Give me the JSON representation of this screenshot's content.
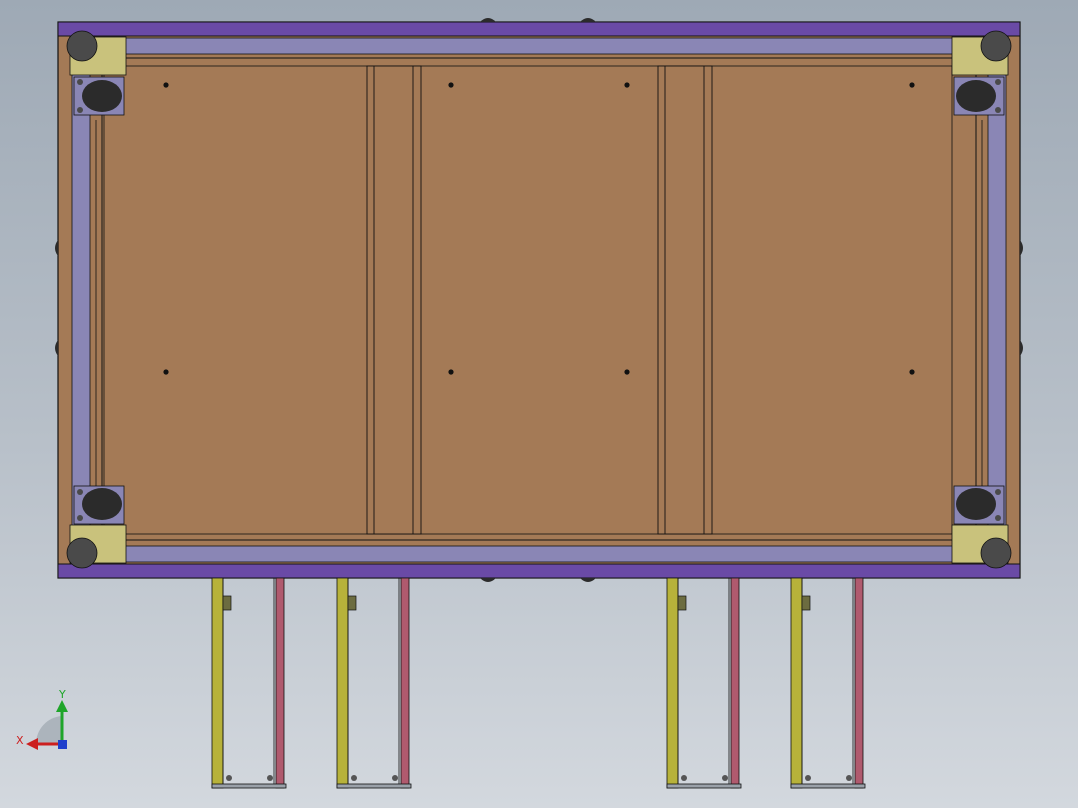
{
  "view": {
    "background_top": "#9ea9b5",
    "background_bottom": "#d3d8de"
  },
  "colors": {
    "frame_rail": "#6a4aa6",
    "frame_rail_dark": "#3d2a66",
    "inner_rail": "#8a86b5",
    "inner_rail_dark": "#4e4b72",
    "panel": "#a47a56",
    "panel_edge": "#6b4a2e",
    "corner_plate": "#c9c27c",
    "caster": "#2b2b2b",
    "caster_bolt": "#4a4a4a",
    "drawer_left_rail": "#b7b23a",
    "drawer_right_rail": "#b05a6e",
    "outline": "#111111"
  },
  "triad": {
    "x_label": "X",
    "y_label": "Y",
    "x_color": "#cc1f1f",
    "y_color": "#1fa52a",
    "z_color": "#1f3fcc"
  },
  "parts": {
    "casters": [
      "caster-top-left",
      "caster-top-right",
      "caster-bottom-left",
      "caster-bottom-right"
    ],
    "drawer_slides": [
      "slide-1",
      "slide-2",
      "slide-3",
      "slide-4"
    ],
    "panels": [
      "panel-left",
      "panel-middle",
      "panel-right"
    ]
  }
}
